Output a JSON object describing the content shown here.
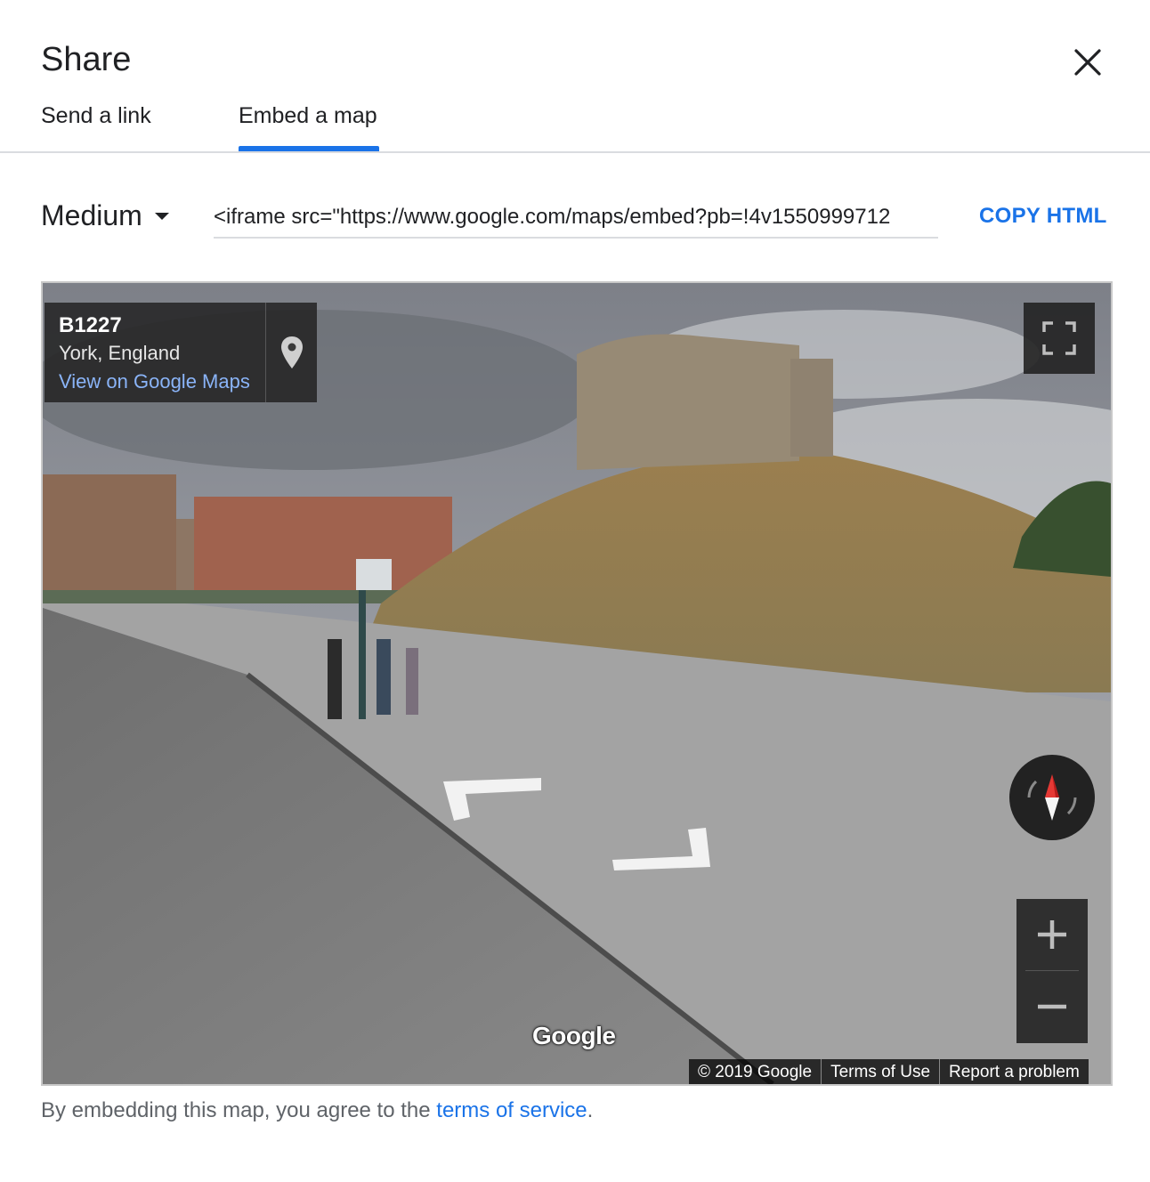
{
  "dialog": {
    "title": "Share",
    "close_icon": "close-icon"
  },
  "tabs": [
    {
      "label": "Send a link",
      "active": false
    },
    {
      "label": "Embed a map",
      "active": true
    }
  ],
  "embed": {
    "size_label": "Medium",
    "html_value": "<iframe src=\"https://www.google.com/maps/embed?pb=!4v1550999712",
    "copy_label": "COPY HTML"
  },
  "map": {
    "road": "B1227",
    "city": "York, England",
    "view_link": "View on Google Maps",
    "logo": "Google",
    "footer": {
      "copyright": "© 2019 Google",
      "terms": "Terms of Use",
      "report": "Report a problem"
    }
  },
  "note": {
    "text": "By embedding this map, you agree to the ",
    "link": "terms of service",
    "end": "."
  },
  "colors": {
    "accent": "#1a73e8",
    "text": "#202124",
    "muted": "#5f6368"
  }
}
